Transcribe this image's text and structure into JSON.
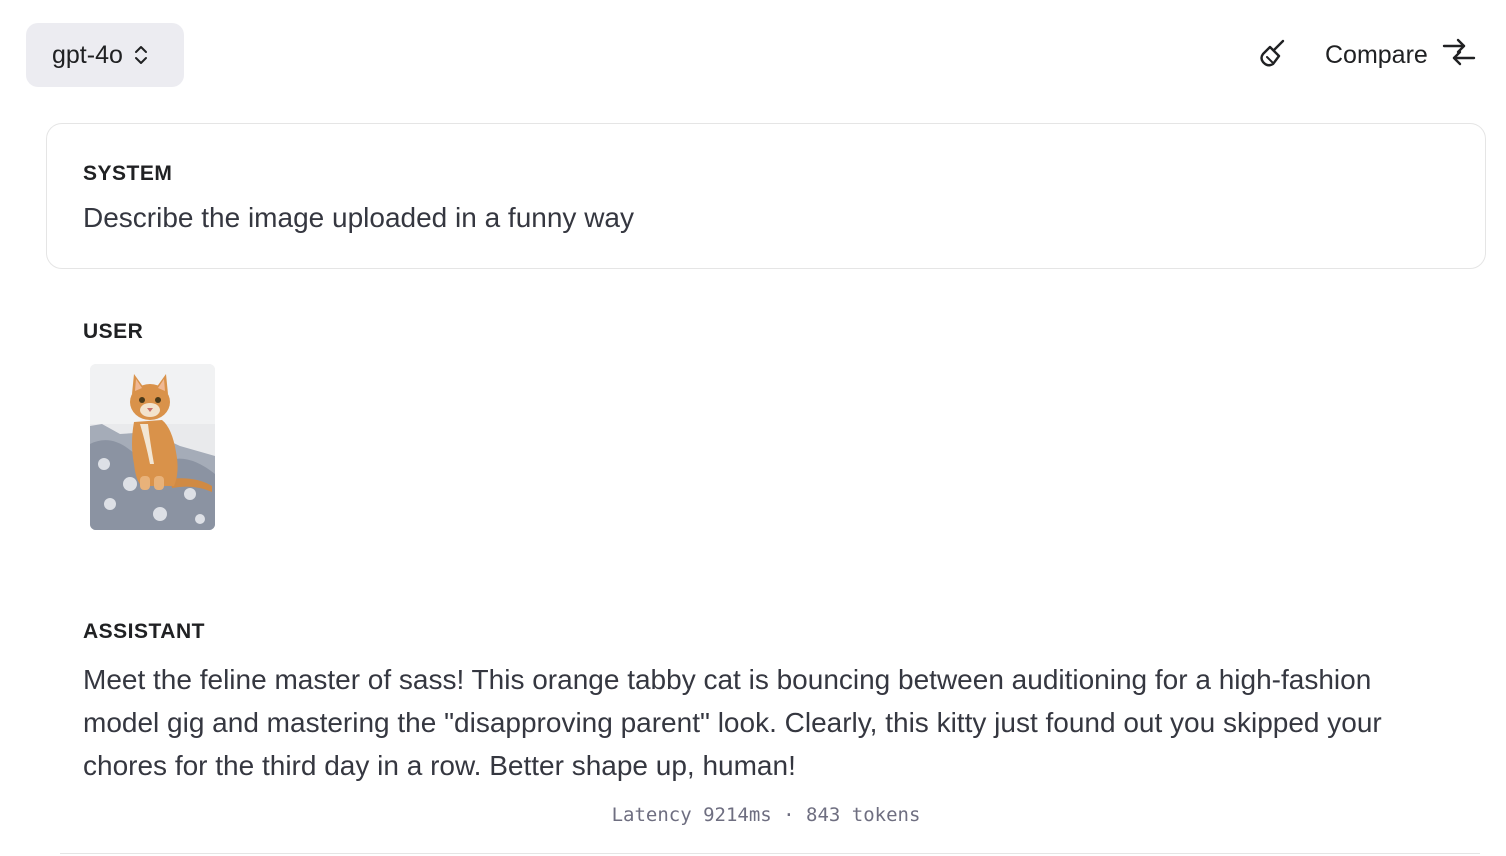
{
  "header": {
    "model_label": "gpt-4o",
    "compare_label": "Compare",
    "clear_icon": "broom-icon",
    "compare_icon": "arrows-compare-icon"
  },
  "system": {
    "role": "SYSTEM",
    "message": "Describe the image uploaded in a funny way"
  },
  "user": {
    "role": "USER",
    "image_icon": "cat-photo"
  },
  "assistant": {
    "role": "ASSISTANT",
    "message": "Meet the feline master of sass! This orange tabby cat is bouncing between auditioning for a high-fashion model gig and mastering the \"disapproving parent\" look. Clearly, this kitty just found out you skipped your chores for the third day in a row. Better shape up, human!",
    "meta": "Latency 9214ms · 843 tokens"
  },
  "colors": {
    "select_bg": "#ececf1",
    "border": "#e5e5e5",
    "text": "#202123",
    "muted": "#6e6e80",
    "cat": "#d9924a"
  }
}
